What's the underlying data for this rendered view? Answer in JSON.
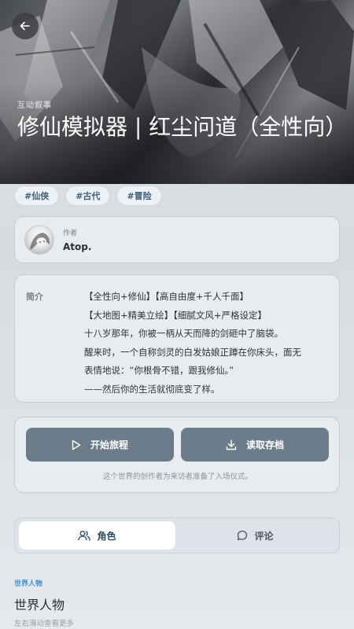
{
  "header": {
    "category": "互动叙事",
    "title": "修仙模拟器 | 红尘问道（全性向）"
  },
  "tags": [
    "#仙侠",
    "#古代",
    "#冒险"
  ],
  "author": {
    "label": "作者",
    "name": "Atop."
  },
  "intro": {
    "label": "简介",
    "lines": [
      "【全性向+修仙】【高自由度+千人千面】",
      "【大地图+精美立绘】【细腻文风+严格设定】",
      "十八岁那年，你被一柄从天而降的剑砸中了脑袋。",
      "醒来时，一个自称剑灵的白发姑娘正蹲在你床头，面无",
      "表情地说：“你根骨不错，跟我修仙。”",
      "——然后你的生活就彻底变了样。"
    ]
  },
  "actions": {
    "start_label": "开始旅程",
    "load_label": "读取存档",
    "note": "这个世界的创作者为来访者准备了入场仪式。"
  },
  "tabs": {
    "characters": "角色",
    "comments": "评论"
  },
  "section": {
    "kicker": "世界人物",
    "title": "世界人物",
    "hint": "左右滑动查看更多"
  },
  "icons": {
    "back": "arrow-left-icon",
    "play": "play-icon",
    "download": "download-icon",
    "users": "users-icon",
    "comment": "comment-icon"
  },
  "colors": {
    "button": "#6b7d8a",
    "tag_text": "#3d5f7a",
    "kicker": "#3b8fd4"
  }
}
